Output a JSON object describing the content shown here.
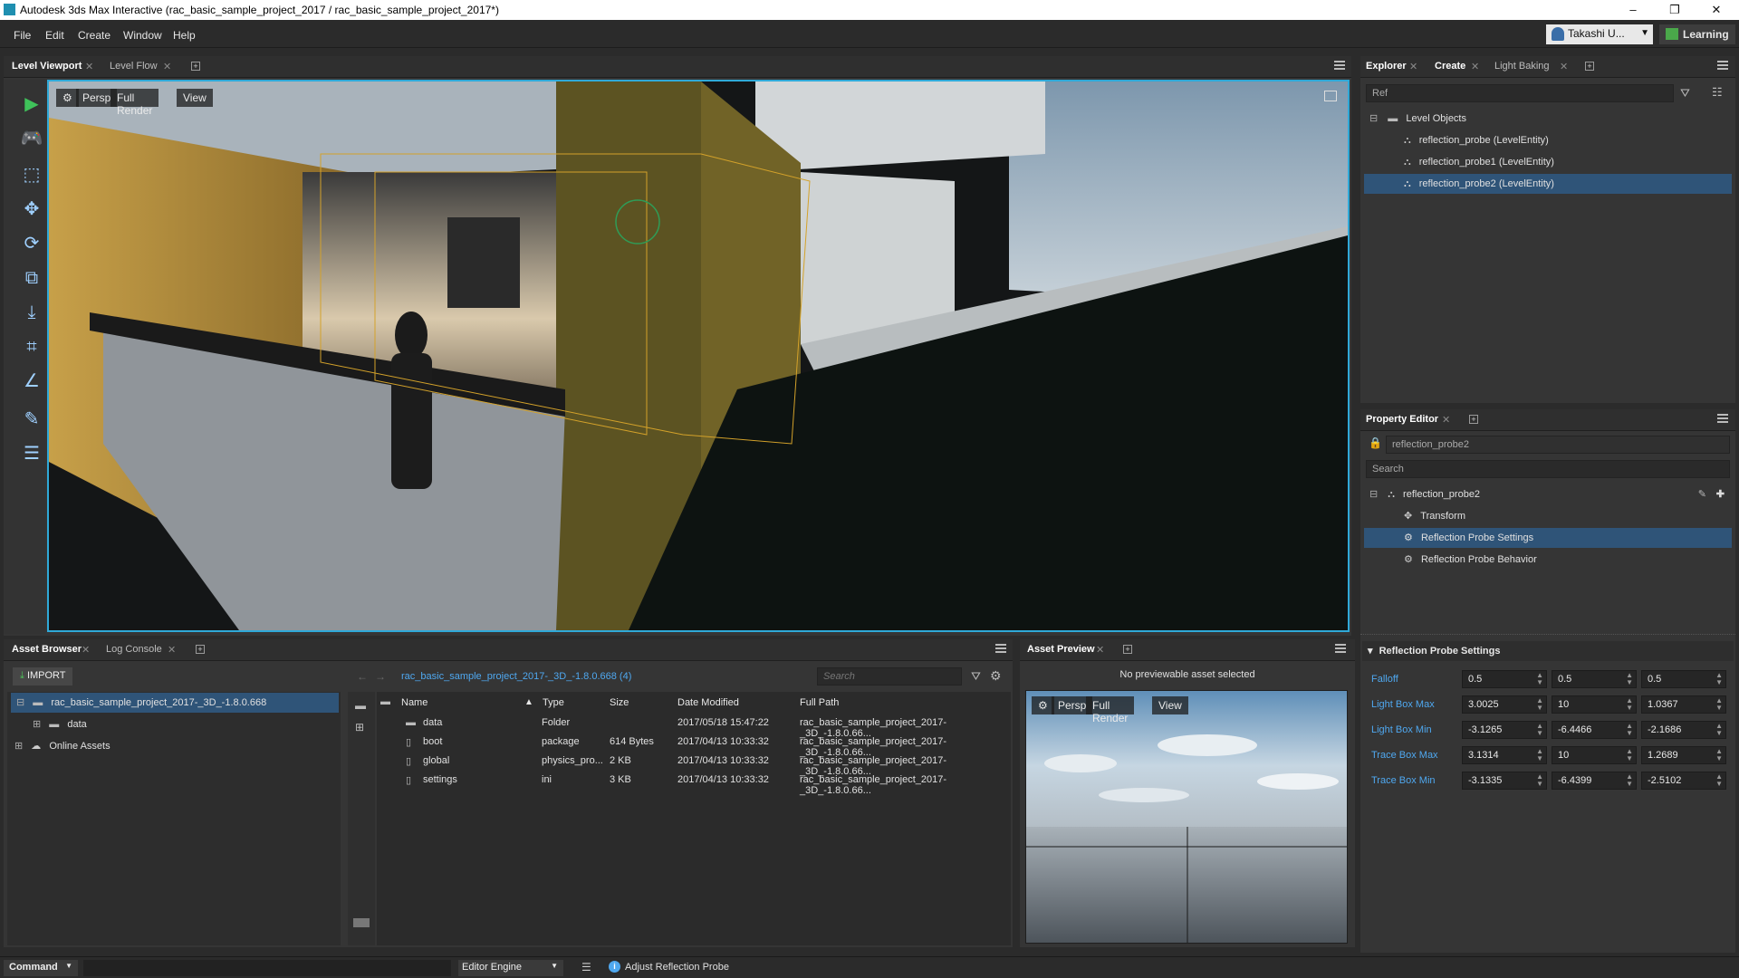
{
  "window": {
    "title": "Autodesk 3ds Max Interactive (rac_basic_sample_project_2017 / rac_basic_sample_project_2017*)",
    "minimize": "–",
    "restore": "❐",
    "close": "✕"
  },
  "menu": {
    "items": [
      "File",
      "Edit",
      "Create",
      "Window",
      "Help"
    ],
    "user": "Takashi U...",
    "learning": "Learning"
  },
  "viewport_panel": {
    "tabs": [
      {
        "label": "Level Viewport",
        "active": true
      },
      {
        "label": "Level Flow",
        "active": false
      }
    ],
    "toolbar": {
      "camera": "Persp",
      "render": "Full Render",
      "view": "View"
    },
    "tools": [
      "play-icon",
      "gamepad-icon",
      "select-icon",
      "move-icon",
      "rotate-icon",
      "scale-icon",
      "snap-icon",
      "pivot-icon",
      "angle-icon",
      "paint-icon",
      "layers-icon"
    ]
  },
  "explorer": {
    "tabs": [
      {
        "label": "Explorer",
        "active": true
      },
      {
        "label": "Create",
        "active": true
      },
      {
        "label": "Light Baking",
        "active": false
      }
    ],
    "search_value": "Ref",
    "root": "Level Objects",
    "items": [
      {
        "label": "reflection_probe (LevelEntity)",
        "selected": false
      },
      {
        "label": "reflection_probe1 (LevelEntity)",
        "selected": false
      },
      {
        "label": "reflection_probe2 (LevelEntity)",
        "selected": true
      }
    ]
  },
  "property_editor": {
    "tab": "Property Editor",
    "object_name": "reflection_probe2",
    "search_placeholder": "Search",
    "root": "reflection_probe2",
    "components": [
      {
        "label": "Transform",
        "selected": false
      },
      {
        "label": "Reflection Probe Settings",
        "selected": true
      },
      {
        "label": "Reflection Probe Behavior",
        "selected": false
      }
    ],
    "section_title": "Reflection Probe Settings",
    "properties": [
      {
        "label": "Falloff",
        "values": [
          "0.5",
          "0.5",
          "0.5"
        ]
      },
      {
        "label": "Light Box Max",
        "values": [
          "3.0025",
          "10",
          "1.0367"
        ]
      },
      {
        "label": "Light Box Min",
        "values": [
          "-3.1265",
          "-6.4466",
          "-2.1686"
        ]
      },
      {
        "label": "Trace Box Max",
        "values": [
          "3.1314",
          "10",
          "1.2689"
        ]
      },
      {
        "label": "Trace Box Min",
        "values": [
          "-3.1335",
          "-6.4399",
          "-2.5102"
        ]
      }
    ]
  },
  "asset_browser": {
    "tabs": [
      {
        "label": "Asset Browser",
        "active": true
      },
      {
        "label": "Log Console",
        "active": false
      }
    ],
    "import_label": "IMPORT",
    "breadcrumb": "rac_basic_sample_project_2017-_3D_-1.8.0.668 (4)",
    "search_placeholder": "Search",
    "tree": [
      {
        "label": "rac_basic_sample_project_2017-_3D_-1.8.0.668",
        "selected": true
      },
      {
        "label": "data",
        "selected": false
      },
      {
        "label": "Online Assets",
        "selected": false
      }
    ],
    "columns": [
      "Name",
      "Type",
      "Size",
      "Date Modified",
      "Full Path"
    ],
    "rows": [
      {
        "name": "data",
        "type": "Folder",
        "size": "",
        "date": "2017/05/18 15:47:22",
        "path": "rac_basic_sample_project_2017-_3D_-1.8.0.66..."
      },
      {
        "name": "boot",
        "type": "package",
        "size": "614 Bytes",
        "date": "2017/04/13 10:33:32",
        "path": "rac_basic_sample_project_2017-_3D_-1.8.0.66..."
      },
      {
        "name": "global",
        "type": "physics_pro...",
        "size": "2 KB",
        "date": "2017/04/13 10:33:32",
        "path": "rac_basic_sample_project_2017-_3D_-1.8.0.66..."
      },
      {
        "name": "settings",
        "type": "ini",
        "size": "3 KB",
        "date": "2017/04/13 10:33:32",
        "path": "rac_basic_sample_project_2017-_3D_-1.8.0.66..."
      }
    ]
  },
  "asset_preview": {
    "tab": "Asset Preview",
    "message": "No previewable asset selected",
    "toolbar": {
      "camera": "Persp",
      "render": "Full Render",
      "view": "View"
    }
  },
  "statusbar": {
    "command_label": "Command",
    "engine_label": "Editor Engine",
    "status_text": "Adjust Reflection Probe"
  },
  "colors": {
    "accent": "#2fa9d8",
    "selection": "#2f5478",
    "prop_label": "#4fa8f0"
  }
}
